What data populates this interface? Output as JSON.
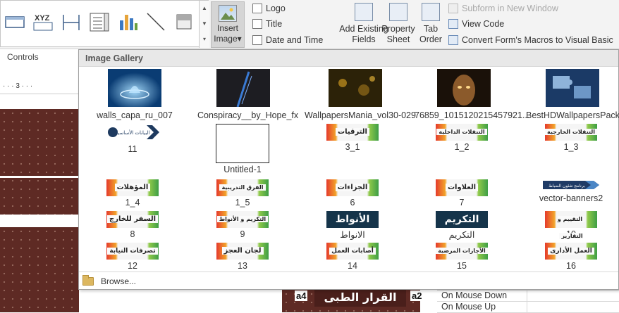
{
  "ribbon": {
    "controls_group_label": "Controls",
    "insert_image_label_1": "Insert",
    "insert_image_label_2": "Image",
    "insert_image_arrow": "▾",
    "logo": "Logo",
    "title": "Title",
    "date_time": "Date and Time",
    "add_existing_1": "Add Existing",
    "add_existing_2": "Fields",
    "property_1": "Property",
    "property_2": "Sheet",
    "tab_1": "Tab",
    "tab_2": "Order",
    "subform_new_window": "Subform in New Window",
    "view_code": "View Code",
    "convert_macros": "Convert Form's Macros to Visual Basic"
  },
  "gallery": {
    "title": "Image Gallery",
    "browse_label": "Browse...",
    "row1": [
      {
        "caption": "walls_capa_ru_007"
      },
      {
        "caption": "Conspiracy__by_Hope_fx"
      },
      {
        "caption": "WallpapersMania_vol30-029"
      },
      {
        "caption": "76859_1015120215457921..."
      },
      {
        "caption": "BestHDWallpapersPack50"
      }
    ],
    "row2": [
      {
        "caption": "11",
        "text": "البيانات الأساسية"
      },
      {
        "caption": "Untitled-1"
      },
      {
        "caption": "3_1",
        "text": "الترقيات"
      },
      {
        "caption": "1_2",
        "text": "التنقلات الداخلية"
      },
      {
        "caption": "1_3",
        "text": "التنقلات الخارجية"
      }
    ],
    "row3": [
      {
        "caption": "1_4",
        "text": "المؤهلات"
      },
      {
        "caption": "1_5",
        "text": "الفرق التدريبية"
      },
      {
        "caption": "6",
        "text": "الجزاءات"
      },
      {
        "caption": "7",
        "text": "العلاوات"
      },
      {
        "caption": "vector-banners2",
        "text": "برنامج شئون الضباط"
      }
    ],
    "row4": [
      {
        "caption": "8",
        "text": "السفر للخارج"
      },
      {
        "caption": "9",
        "text": "التكريم و الأنواط"
      },
      {
        "caption": "الانواط",
        "text": "الأنواط"
      },
      {
        "caption": "التكريم",
        "text": "التكريم"
      },
      {
        "caption": "10",
        "text": "التقييم و التقارير"
      }
    ],
    "row5": [
      {
        "caption": "12",
        "text": "تصرفات النيابة"
      },
      {
        "caption": "13",
        "text": "لجان العجز"
      },
      {
        "caption": "14",
        "text": "أصابات العمل"
      },
      {
        "caption": "15",
        "text": "الأجازات المرضية"
      },
      {
        "caption": "16",
        "text": "العمل الأدارى"
      }
    ]
  },
  "form": {
    "ruler_text": "· · · 3 · · ·",
    "a4_label_left": "a4",
    "a4_label_right": "a2",
    "arabic_title": "القرار الطبى"
  },
  "property_sheet": {
    "rows": [
      {
        "name": "On Mouse Down"
      },
      {
        "name": "On Mouse Up"
      }
    ]
  },
  "colors": {
    "form_background": "#5e2a24",
    "dark_banner": "#15344a"
  }
}
